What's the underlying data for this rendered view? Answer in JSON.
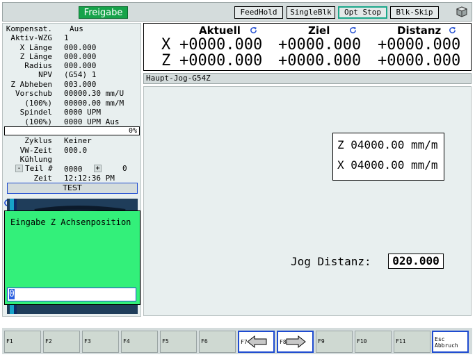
{
  "topbar": {
    "status": "Freigabe",
    "buttons": [
      "FeedHold",
      "SingleBlk",
      "Opt Stop",
      "Blk-Skip"
    ]
  },
  "info": {
    "rows": [
      {
        "label": "Kompensat.",
        "value": "Aus"
      },
      {
        "label": "Aktiv-WZG",
        "value": "1"
      },
      {
        "label": "X Länge",
        "value": "000.000"
      },
      {
        "label": "Z Länge",
        "value": "000.000"
      },
      {
        "label": "Radius",
        "value": "000.000"
      },
      {
        "label": "NPV",
        "value": "(G54) 1"
      },
      {
        "label": "Z Abheben",
        "value": "003.000"
      },
      {
        "label": "Vorschub",
        "value": "00000.30 mm/U"
      },
      {
        "label": "(100%)",
        "value": "00000.00 mm/M"
      },
      {
        "label": "Spindel",
        "value": "0000 UPM"
      },
      {
        "label": "(100%)",
        "value": "0000 UPM Aus"
      }
    ],
    "progress_text": "0%",
    "progress": 0,
    "rows2": [
      {
        "label": "Zyklus",
        "value": "Keiner"
      },
      {
        "label": "VW-Zeit",
        "value": "000.0"
      },
      {
        "label": "Kühlung",
        "value": ""
      }
    ],
    "teil_label": "Teil #",
    "teil_minus": "-",
    "teil_value": "0000",
    "teil_plus": "+",
    "teil_count": "0",
    "zeit_label": "Zeit",
    "zeit_value": "12:12:36 PM",
    "test_label": "TEST"
  },
  "coords": {
    "headers": [
      "Aktuell",
      "Ziel",
      "Distanz"
    ],
    "axes": [
      {
        "axis": "X",
        "values": [
          "+0000.000",
          "+0000.000",
          "+0000.000"
        ]
      },
      {
        "axis": "Z",
        "values": [
          "+0000.000",
          "+0000.000",
          "+0000.000"
        ]
      }
    ]
  },
  "jog": {
    "title": "Haupt-Jog-G54Z",
    "feed": [
      "Z 04000.00 mm/m",
      "X 04000.00 mm/m"
    ],
    "distance_label": "Jog Distanz:",
    "distance_value": "020.000"
  },
  "dialog": {
    "title": "Eingabe Z Achsenposition",
    "input_value": "0"
  },
  "fkeys": [
    {
      "label": "F1"
    },
    {
      "label": "F2"
    },
    {
      "label": "F3"
    },
    {
      "label": "F4"
    },
    {
      "label": "F5"
    },
    {
      "label": "F6"
    },
    {
      "label": "F7",
      "icon": "arrow-left-icon"
    },
    {
      "label": "F8",
      "icon": "arrow-right-icon"
    },
    {
      "label": "F9"
    },
    {
      "label": "F10"
    },
    {
      "label": "F11"
    },
    {
      "label": "Esc\nAbbruch"
    }
  ],
  "colors": {
    "status_green": "#16a34a",
    "dialog_green": "#33f07a",
    "accent_blue": "#1e4bd0",
    "panel_bg": "#e8efef"
  }
}
